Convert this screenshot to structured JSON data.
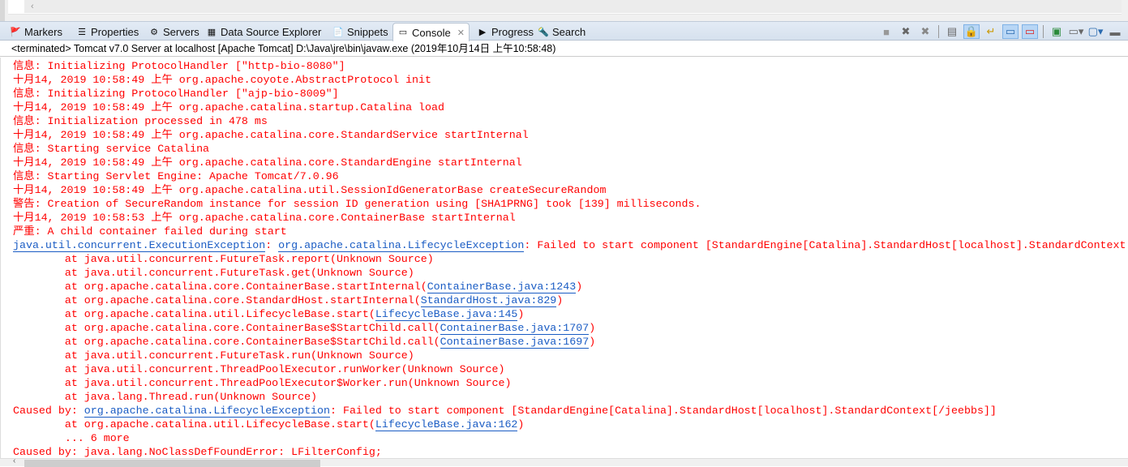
{
  "tabs": [
    {
      "label": "Markers",
      "icon": "markers-icon"
    },
    {
      "label": "Properties",
      "icon": "properties-icon"
    },
    {
      "label": "Servers",
      "icon": "servers-icon"
    },
    {
      "label": "Data Source Explorer",
      "icon": "data-source-icon"
    },
    {
      "label": "Snippets",
      "icon": "snippets-icon"
    },
    {
      "label": "Console",
      "icon": "console-icon",
      "active": true
    },
    {
      "label": "Progress",
      "icon": "progress-icon"
    },
    {
      "label": "Search",
      "icon": "search-icon"
    }
  ],
  "toolbar": [
    "terminate",
    "remove-launch",
    "remove-all-terminated",
    "clear-console",
    "scroll-lock",
    "word-wrap",
    "show-on-stdout",
    "show-on-stderr",
    "pin-console",
    "display-selected-console",
    "open-console",
    "minimize"
  ],
  "status": "<terminated> Tomcat v7.0 Server at localhost [Apache Tomcat] D:\\Java\\jre\\bin\\javaw.exe (2019年10月14日 上午10:58:48)",
  "colors": {
    "error": "#ff0000",
    "link": "#1a5cc4"
  },
  "lines": [
    [
      {
        "t": "信息: Initializing ProtocolHandler [\"http-bio-8080\"]"
      }
    ],
    [
      {
        "t": "十月14, 2019 10:58:49 上午 org.apache.coyote.AbstractProtocol init"
      }
    ],
    [
      {
        "t": "信息: Initializing ProtocolHandler [\"ajp-bio-8009\"]"
      }
    ],
    [
      {
        "t": "十月14, 2019 10:58:49 上午 org.apache.catalina.startup.Catalina load"
      }
    ],
    [
      {
        "t": "信息: Initialization processed in 478 ms"
      }
    ],
    [
      {
        "t": "十月14, 2019 10:58:49 上午 org.apache.catalina.core.StandardService startInternal"
      }
    ],
    [
      {
        "t": "信息: Starting service Catalina"
      }
    ],
    [
      {
        "t": "十月14, 2019 10:58:49 上午 org.apache.catalina.core.StandardEngine startInternal"
      }
    ],
    [
      {
        "t": "信息: Starting Servlet Engine: Apache Tomcat/7.0.96"
      }
    ],
    [
      {
        "t": "十月14, 2019 10:58:49 上午 org.apache.catalina.util.SessionIdGeneratorBase createSecureRandom"
      }
    ],
    [
      {
        "t": "警告: Creation of SecureRandom instance for session ID generation using [SHA1PRNG] took [139] milliseconds."
      }
    ],
    [
      {
        "t": "十月14, 2019 10:58:53 上午 org.apache.catalina.core.ContainerBase startInternal"
      }
    ],
    [
      {
        "t": "严重: A child container failed during start"
      }
    ],
    [
      {
        "t": "java.util.concurrent.ExecutionException",
        "link": true
      },
      {
        "t": ": "
      },
      {
        "t": "org.apache.catalina.LifecycleException",
        "link": true
      },
      {
        "t": ": Failed to start component [StandardEngine[Catalina].StandardHost[localhost].StandardContext"
      }
    ],
    [
      {
        "t": "\tat java.util.concurrent.FutureTask.report(Unknown Source)"
      }
    ],
    [
      {
        "t": "\tat java.util.concurrent.FutureTask.get(Unknown Source)"
      }
    ],
    [
      {
        "t": "\tat org.apache.catalina.core.ContainerBase.startInternal("
      },
      {
        "t": "ContainerBase.java:1243",
        "link": true
      },
      {
        "t": ")"
      }
    ],
    [
      {
        "t": "\tat org.apache.catalina.core.StandardHost.startInternal("
      },
      {
        "t": "StandardHost.java:829",
        "link": true
      },
      {
        "t": ")"
      }
    ],
    [
      {
        "t": "\tat org.apache.catalina.util.LifecycleBase.start("
      },
      {
        "t": "LifecycleBase.java:145",
        "link": true
      },
      {
        "t": ")"
      }
    ],
    [
      {
        "t": "\tat org.apache.catalina.core.ContainerBase$StartChild.call("
      },
      {
        "t": "ContainerBase.java:1707",
        "link": true
      },
      {
        "t": ")"
      }
    ],
    [
      {
        "t": "\tat org.apache.catalina.core.ContainerBase$StartChild.call("
      },
      {
        "t": "ContainerBase.java:1697",
        "link": true
      },
      {
        "t": ")"
      }
    ],
    [
      {
        "t": "\tat java.util.concurrent.FutureTask.run(Unknown Source)"
      }
    ],
    [
      {
        "t": "\tat java.util.concurrent.ThreadPoolExecutor.runWorker(Unknown Source)"
      }
    ],
    [
      {
        "t": "\tat java.util.concurrent.ThreadPoolExecutor$Worker.run(Unknown Source)"
      }
    ],
    [
      {
        "t": "\tat java.lang.Thread.run(Unknown Source)"
      }
    ],
    [
      {
        "t": "Caused by: "
      },
      {
        "t": "org.apache.catalina.LifecycleException",
        "link": true
      },
      {
        "t": ": Failed to start component [StandardEngine[Catalina].StandardHost[localhost].StandardContext[/jeebbs]]"
      }
    ],
    [
      {
        "t": "\tat org.apache.catalina.util.LifecycleBase.start("
      },
      {
        "t": "LifecycleBase.java:162",
        "link": true
      },
      {
        "t": ")"
      }
    ],
    [
      {
        "t": "\t... 6 more"
      }
    ],
    [
      {
        "t": "Caused by: java.lang.NoClassDefFoundError: LFilterConfig;"
      }
    ]
  ]
}
